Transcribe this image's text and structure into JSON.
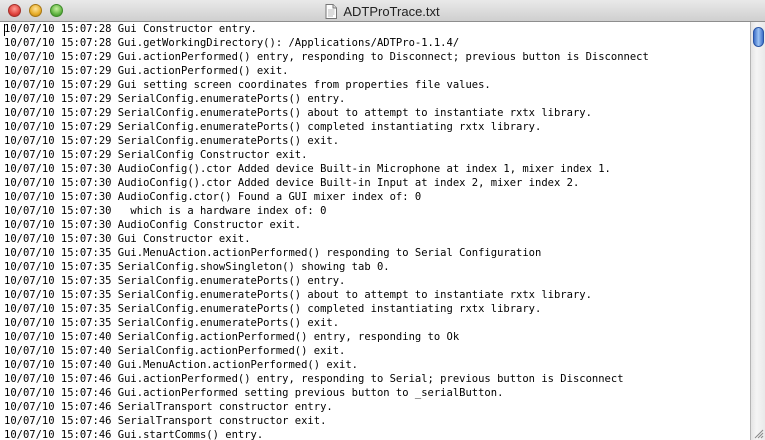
{
  "window": {
    "title": "ADTProTrace.txt",
    "icons": {
      "close": "close-icon",
      "minimize": "minimize-icon",
      "zoom": "zoom-icon",
      "document": "document-icon"
    }
  },
  "log": {
    "lines": [
      "10/07/10 15:07:28 Gui Constructor entry.",
      "10/07/10 15:07:28 Gui.getWorkingDirectory(): /Applications/ADTPro-1.1.4/",
      "10/07/10 15:07:29 Gui.actionPerformed() entry, responding to Disconnect; previous button is Disconnect",
      "10/07/10 15:07:29 Gui.actionPerformed() exit.",
      "10/07/10 15:07:29 Gui setting screen coordinates from properties file values.",
      "10/07/10 15:07:29 SerialConfig.enumeratePorts() entry.",
      "10/07/10 15:07:29 SerialConfig.enumeratePorts() about to attempt to instantiate rxtx library.",
      "10/07/10 15:07:29 SerialConfig.enumeratePorts() completed instantiating rxtx library.",
      "10/07/10 15:07:29 SerialConfig.enumeratePorts() exit.",
      "10/07/10 15:07:29 SerialConfig Constructor exit.",
      "10/07/10 15:07:30 AudioConfig().ctor Added device Built-in Microphone at index 1, mixer index 1.",
      "10/07/10 15:07:30 AudioConfig().ctor Added device Built-in Input at index 2, mixer index 2.",
      "10/07/10 15:07:30 AudioConfig.ctor() Found a GUI mixer index of: 0",
      "10/07/10 15:07:30   which is a hardware index of: 0",
      "10/07/10 15:07:30 AudioConfig Constructor exit.",
      "10/07/10 15:07:30 Gui Constructor exit.",
      "10/07/10 15:07:35 Gui.MenuAction.actionPerformed() responding to Serial Configuration",
      "10/07/10 15:07:35 SerialConfig.showSingleton() showing tab 0.",
      "10/07/10 15:07:35 SerialConfig.enumeratePorts() entry.",
      "10/07/10 15:07:35 SerialConfig.enumeratePorts() about to attempt to instantiate rxtx library.",
      "10/07/10 15:07:35 SerialConfig.enumeratePorts() completed instantiating rxtx library.",
      "10/07/10 15:07:35 SerialConfig.enumeratePorts() exit.",
      "10/07/10 15:07:40 SerialConfig.actionPerformed() entry, responding to Ok",
      "10/07/10 15:07:40 SerialConfig.actionPerformed() exit.",
      "10/07/10 15:07:40 Gui.MenuAction.actionPerformed() exit.",
      "10/07/10 15:07:46 Gui.actionPerformed() entry, responding to Serial; previous button is Disconnect",
      "10/07/10 15:07:46 Gui.actionPerformed setting previous button to _serialButton.",
      "10/07/10 15:07:46 SerialTransport constructor entry.",
      "10/07/10 15:07:46 SerialTransport constructor exit.",
      "10/07/10 15:07:46 Gui.startComms() entry."
    ]
  },
  "scrollbar": {
    "position": 0
  },
  "colors": {
    "spellcheck_underline": "#e0201a",
    "scroll_thumb": "#5a8fe0"
  }
}
